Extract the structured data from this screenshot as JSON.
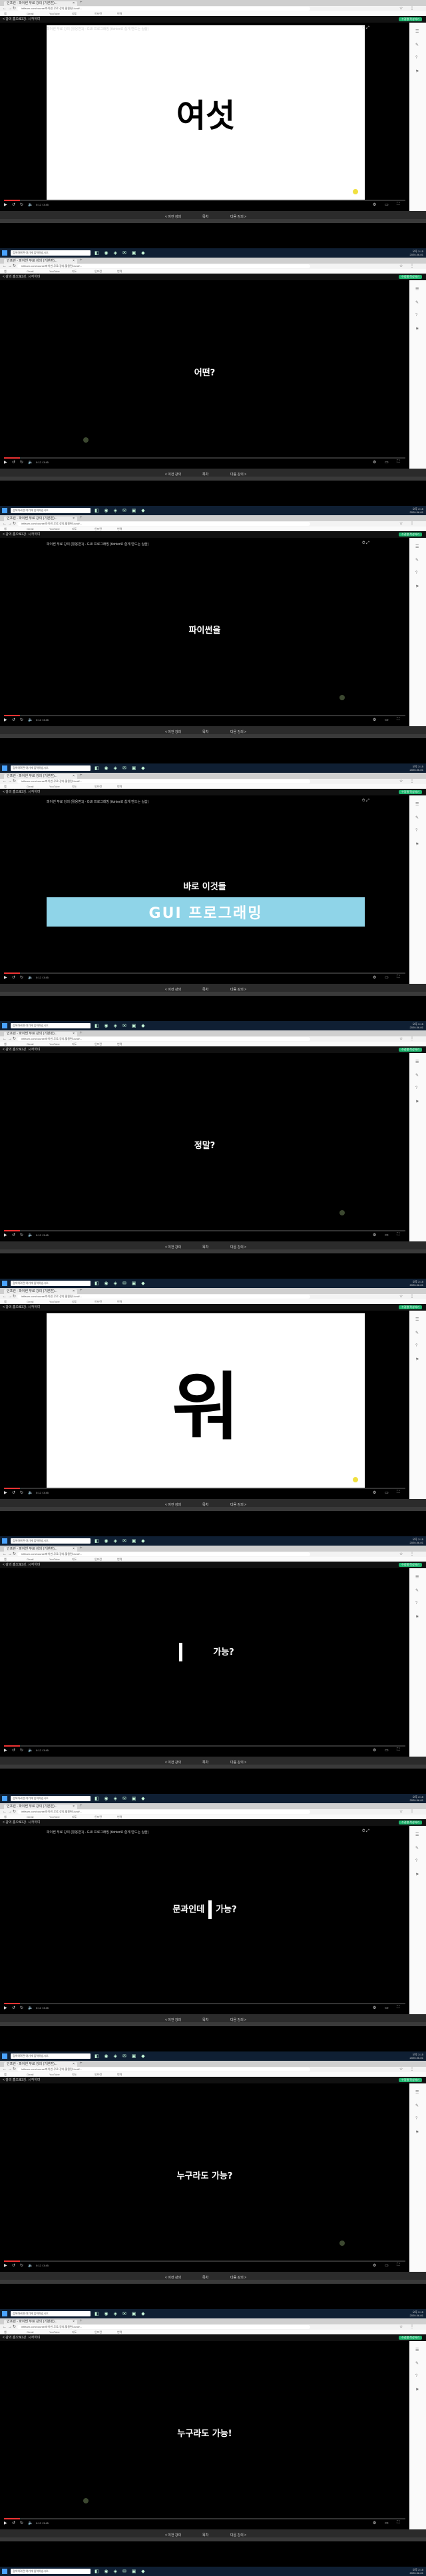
{
  "browser": {
    "tab_title": "인프런 - 파이썬 무료 강의 (기본편)...",
    "tab_close": "×",
    "new_tab": "+",
    "address": "inflearn.com/course/파이썬-무료-강의-활용편1/unit/...",
    "bookmarks": [
      "앱",
      "Gmail",
      "YouTube",
      "지도",
      "인프런",
      "번역"
    ]
  },
  "page": {
    "back_label": "< 강의 홈으로",
    "title_label": "1강. 시작하며",
    "cta_label": "수강평 작성하기"
  },
  "video": {
    "title": "파이썬 무료 강의 (활용편1) - GUI 프로그래밍 (tkinter로 쉽게 만드는 실습)",
    "top_icons": "⏱ ⤢"
  },
  "frames": [
    {
      "kind": "slide",
      "text": "여섯",
      "size": 48,
      "show_title": true
    },
    {
      "kind": "caption",
      "text": "어떤?",
      "show_title": false
    },
    {
      "kind": "caption",
      "text": "파이썬을",
      "show_title": true
    },
    {
      "kind": "banner",
      "text": "바로 이것들",
      "banner": "GUI 프로그래밍",
      "show_title": true
    },
    {
      "kind": "caption",
      "text": "정말?",
      "show_title": false
    },
    {
      "kind": "slide",
      "text": "워",
      "size": 110,
      "show_title": false
    },
    {
      "kind": "caret",
      "left": "",
      "right": "가능?",
      "show_title": false
    },
    {
      "kind": "caret",
      "left": "문과인데",
      "right": "가능?",
      "show_title": true
    },
    {
      "kind": "caption",
      "text": "누구라도  가능?",
      "show_title": false
    },
    {
      "kind": "caption",
      "text": "누구라도  가능!",
      "show_title": false
    }
  ],
  "controls": {
    "time": "0:12 / 3:45",
    "progress_pct": 4
  },
  "lecture_nav": {
    "prev": "< 이전 강의",
    "list": "목차",
    "next": "다음 강의 >"
  },
  "taskbar": {
    "search_placeholder": "검색하려면 여기에 입력하십시오.",
    "apps": "◧ ◉ ◈ ✉ ▣ ◆",
    "clock": "오후 2:15\n2020-06-01"
  }
}
